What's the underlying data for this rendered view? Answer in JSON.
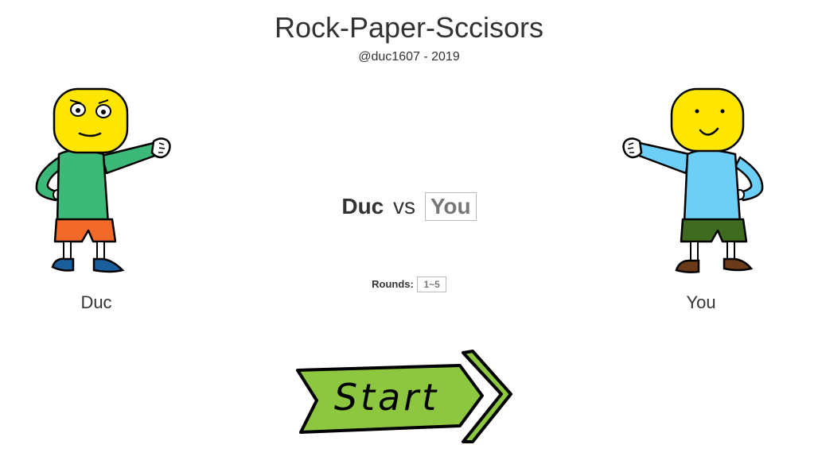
{
  "header": {
    "title": "Rock-Paper-Sccisors",
    "subtitle": "@duc1607 - 2019"
  },
  "players": {
    "left": {
      "name": "Duc",
      "shirt_color": "#3cb878",
      "shorts_color": "#f26a2a",
      "shoes_color": "#1a5f9c",
      "face_color": "#ffe600"
    },
    "right": {
      "name": "You",
      "shirt_color": "#6dcff6",
      "shorts_color": "#3e6b1f",
      "shoes_color": "#6b3a18",
      "face_color": "#ffe600"
    }
  },
  "versus": {
    "player1": "Duc",
    "separator": "vs",
    "player2": "You"
  },
  "rounds": {
    "label": "Rounds:",
    "value": "1~5"
  },
  "start_button": {
    "label": "Start",
    "color": "#8dc63f"
  }
}
